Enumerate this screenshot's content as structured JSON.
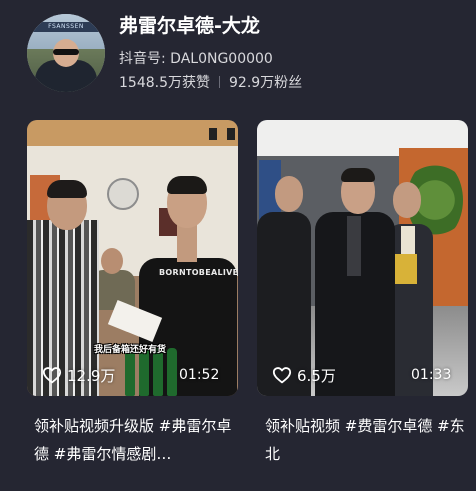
{
  "profile": {
    "name": "弗雷尔卓德-大龙",
    "douyin_id": "抖音号: DAL0NG00000",
    "likes": "1548.5万获赞",
    "fans": "92.9万粉丝",
    "avatar_banner": "FSANSSEN"
  },
  "videos": [
    {
      "likes": "12.9万",
      "duration": "01:52",
      "title": "领补贴视频升级版 #弗雷尔卓德 #弗雷尔情感剧…",
      "subtitle": "我后备箱还好有货",
      "shirt_text": "BORNTOBEALIVE"
    },
    {
      "likes": "6.5万",
      "duration": "01:33",
      "title": "领补贴视频 #费雷尔卓德 #东北"
    }
  ],
  "icons": {
    "like": "heart-outline-icon"
  },
  "colors": {
    "background": "#252632",
    "text": "#ffffff",
    "secondary_text": "#d8d8dc"
  }
}
